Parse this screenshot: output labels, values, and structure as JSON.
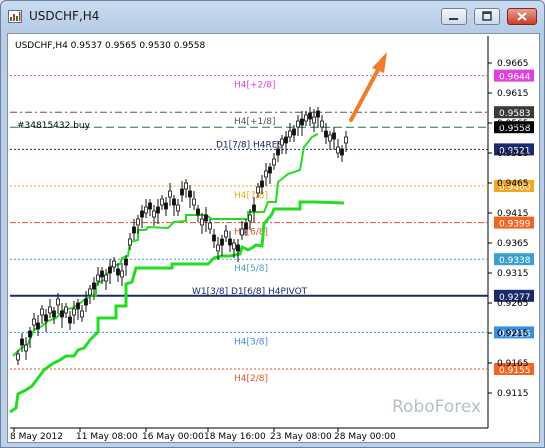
{
  "window": {
    "title": "USDCHF,H4",
    "buttons": [
      "minimize-icon",
      "restore-icon",
      "close-icon"
    ]
  },
  "header": {
    "symbol_line": "USDCHF,H4  0.9537 0.9565 0.9530 0.9558"
  },
  "order_label": "#34815432 buy",
  "watermark": "RoboForex",
  "levels": [
    {
      "label": "H4[+2/8]",
      "price": "0.9644",
      "color": "#e040e0",
      "badge_bg": "#e040e0",
      "badge_fg": "#ffffff"
    },
    {
      "label": "H4[+1/8]",
      "price": "0.9583",
      "color": "#555555",
      "badge_bg": "#3a3a3a",
      "badge_fg": "#ffffff"
    },
    {
      "label": "D1[7/8] H4RES",
      "price": "0.9521",
      "color": "#1a2a6c",
      "badge_bg": "#1a2a6c",
      "badge_fg": "#ffffff"
    },
    {
      "label": "H4[7/8]",
      "price": "0.9460",
      "color": "#f5a623",
      "badge_bg": "#f5a623",
      "badge_fg": "#ffffff"
    },
    {
      "label": "H4[6/8]",
      "price": "0.9399",
      "color": "#d9532b",
      "badge_bg": "#f26522",
      "badge_fg": "#ffffff"
    },
    {
      "label": "H4[5/8]",
      "price": "0.9338",
      "color": "#4aa3c8",
      "badge_bg": "#3aa0d0",
      "badge_fg": "#ffffff"
    },
    {
      "label": "W1[3/8] D1[6/8] H4PIVOT",
      "price": "0.9277",
      "color": "#1a2a6c",
      "badge_bg": "#1a2a6c",
      "badge_fg": "#ffffff"
    },
    {
      "label": "H4[3/8]",
      "price": "0.9216",
      "color": "#3d8fe0",
      "badge_bg": "#3d8fe0",
      "badge_fg": "#ffffff"
    },
    {
      "label": "H4[2/8]",
      "price": "0.9155",
      "color": "#e8562b",
      "badge_bg": "#f26522",
      "badge_fg": "#ffffff"
    }
  ],
  "current_price": "0.9558",
  "y_ticks": [
    "0.9665",
    "0.9615",
    "0.9565",
    "0.9515",
    "0.9465",
    "0.9415",
    "0.9365",
    "0.9315",
    "0.9265",
    "0.9215",
    "0.9165",
    "0.9115"
  ],
  "x_ticks": [
    "8 May 2012",
    "11 May 08:00",
    "16 May 00:00",
    "18 May 16:00",
    "23 May 08:00",
    "28 May 00:00"
  ],
  "colors": {
    "trail": "#22dd22",
    "candles": "#111111",
    "arrow": "#f07d2a"
  }
}
